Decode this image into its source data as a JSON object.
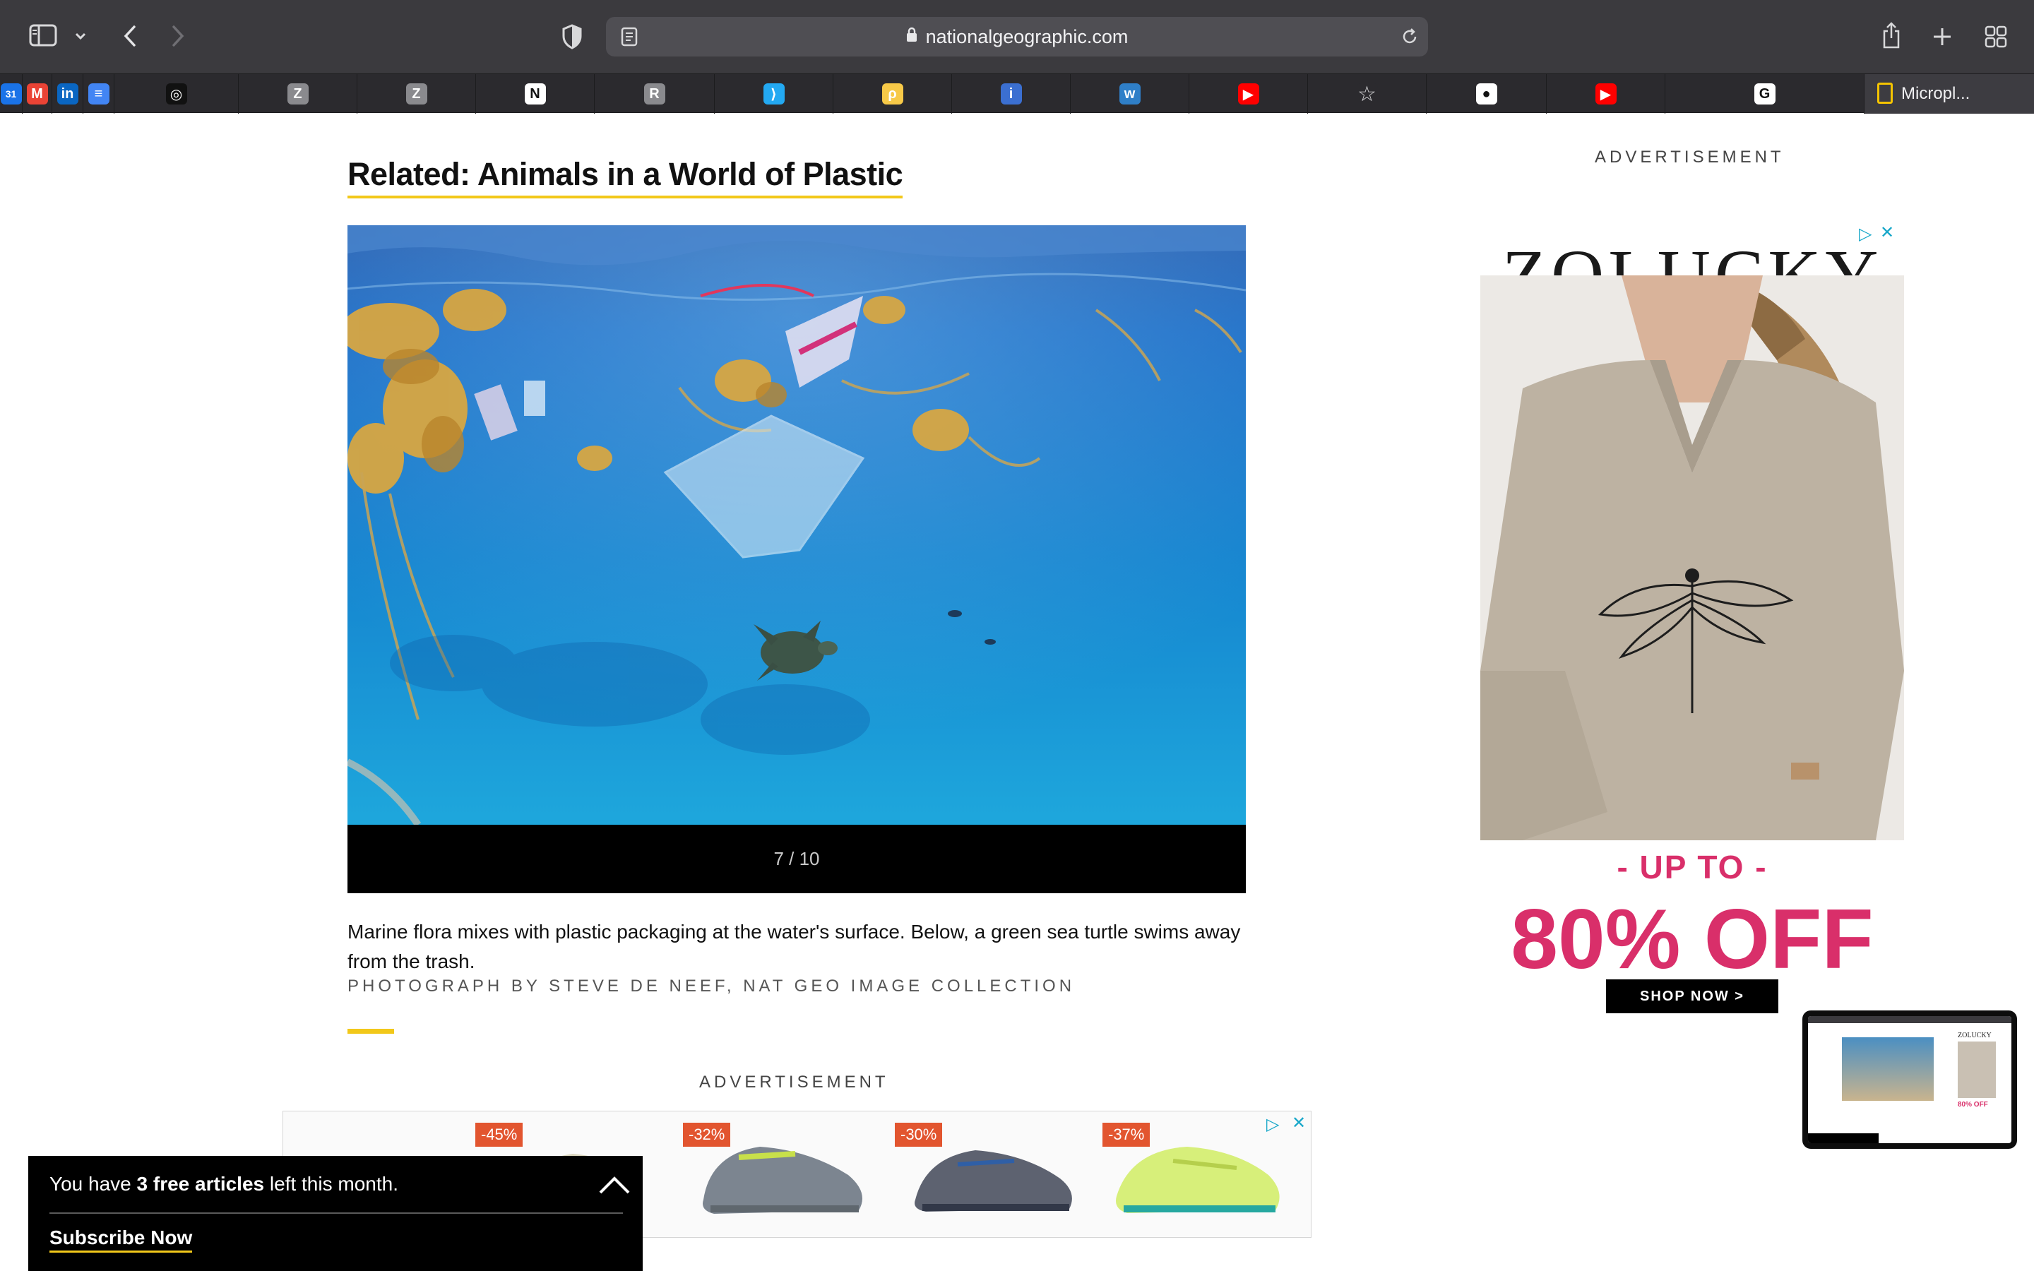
{
  "browser": {
    "url": "nationalgeographic.com",
    "last_tab_label": "Micropl..."
  },
  "bookmarks": [
    {
      "icon": "google-calendar-icon",
      "glyph": "31",
      "color": "#1a73e8"
    },
    {
      "icon": "gmail-icon",
      "glyph": "M",
      "color": "#ea4335"
    },
    {
      "icon": "linkedin-icon",
      "glyph": "in",
      "color": "#0a66c2"
    },
    {
      "icon": "google-docs-icon",
      "glyph": "≡",
      "color": "#4285f4"
    },
    {
      "icon": "spiral-icon",
      "glyph": "◎",
      "color": "#111111"
    },
    {
      "icon": "zotero-icon",
      "glyph": "Z",
      "color": "#8a8a8e"
    },
    {
      "icon": "zotero-icon",
      "glyph": "Z",
      "color": "#8a8a8e"
    },
    {
      "icon": "notion-icon",
      "glyph": "N",
      "color": "#ffffff"
    },
    {
      "icon": "r-icon",
      "glyph": "R",
      "color": "#8a8a8e"
    },
    {
      "icon": "vscode-icon",
      "glyph": "⟩",
      "color": "#23a9f2"
    },
    {
      "icon": "python-icon",
      "glyph": "ρ",
      "color": "#f7c948"
    },
    {
      "icon": "info-icon",
      "glyph": "i",
      "color": "#3b6fd1"
    },
    {
      "icon": "w-icon",
      "glyph": "w",
      "color": "#2f7fc8"
    },
    {
      "icon": "youtube-icon",
      "glyph": "▶",
      "color": "#ff0000"
    },
    {
      "icon": "star-icon",
      "glyph": "☆",
      "color": "#2b2a2e"
    },
    {
      "icon": "github-icon",
      "glyph": "●",
      "color": "#ffffff"
    },
    {
      "icon": "youtube-icon",
      "glyph": "▶",
      "color": "#ff0000"
    },
    {
      "icon": "google-icon",
      "glyph": "G",
      "color": "#ffffff"
    }
  ],
  "article": {
    "related_link": "Related: Animals in a World of Plastic",
    "slide_counter": "7 / 10",
    "caption": "Marine flora mixes with plastic packaging at the water's surface. Below, a green sea turtle swims away from the trash.",
    "credit": "Photograph by Steve De Neef, Nat Geo Image Collection"
  },
  "ads": {
    "label": "ADVERTISEMENT",
    "bottom_discounts": [
      "-45%",
      "-32%",
      "-30%",
      "-37%"
    ],
    "side": {
      "brand": "ZOLUCKY",
      "promo_top": "- UP TO -",
      "promo_main": "80% OFF",
      "cta": "SHOP NOW >"
    }
  },
  "paywall": {
    "prefix": "You have ",
    "count": "3 free articles",
    "suffix": " left this month.",
    "subscribe": "Subscribe Now"
  },
  "pip": {
    "brand": "ZOLUCKY",
    "promo": "80% OFF"
  }
}
